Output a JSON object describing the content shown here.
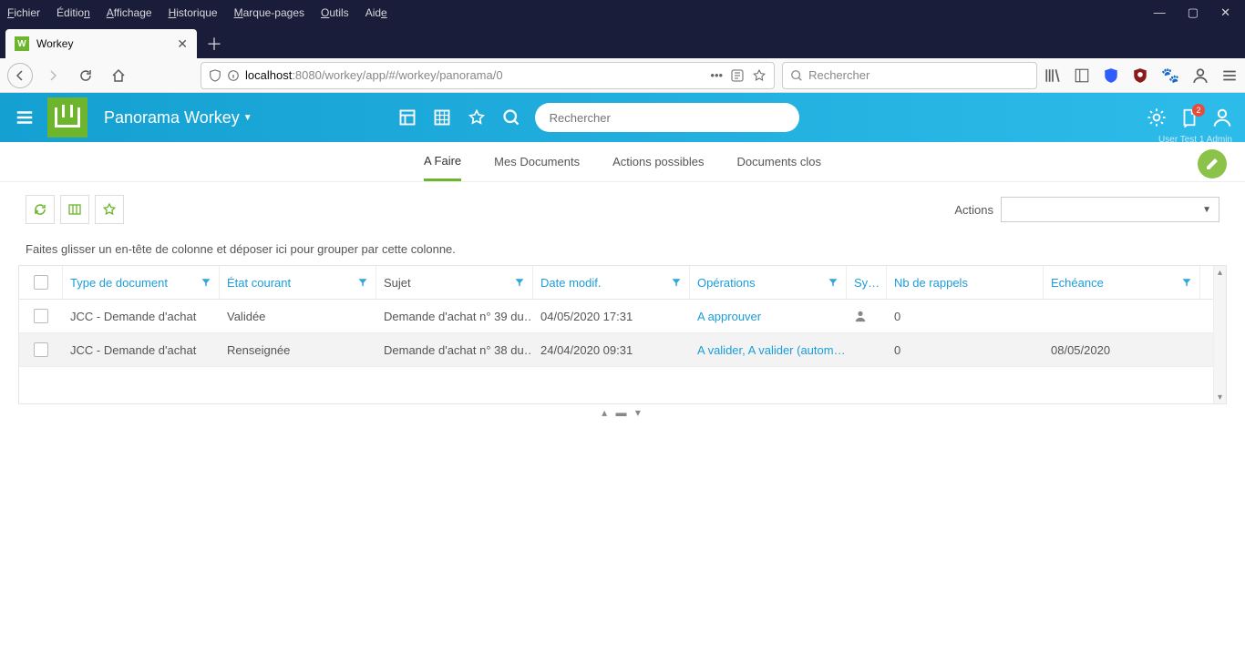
{
  "browser": {
    "menus": [
      "Fichier",
      "Édition",
      "Affichage",
      "Historique",
      "Marque-pages",
      "Outils",
      "Aide"
    ],
    "tab_title": "Workey",
    "url_prefix": "localhost",
    "url_port": ":8080",
    "url_path": "/workey/app/#/workey/panorama/0",
    "search_placeholder": "Rechercher"
  },
  "app": {
    "title": "Panorama Workey",
    "search_placeholder": "Rechercher",
    "notif_count": "2",
    "user_label": "User Test 1 Admin"
  },
  "tabs": {
    "t0": "A Faire",
    "t1": "Mes Documents",
    "t2": "Actions possibles",
    "t3": "Documents clos"
  },
  "toolbar": {
    "actions_label": "Actions"
  },
  "group_hint": "Faites glisser un en-tête de colonne et déposer ici pour grouper par cette colonne.",
  "columns": {
    "type": "Type de document",
    "etat": "État courant",
    "sujet": "Sujet",
    "date": "Date modif.",
    "oper": "Opérations",
    "sync": "Sy…",
    "rappel": "Nb de rappels",
    "eche": "Echéance"
  },
  "rows": [
    {
      "type": "JCC - Demande d'achat",
      "etat": "Validée",
      "sujet": "Demande d'achat n° 39 du…",
      "date": "04/05/2020 17:31",
      "oper": "A approuver",
      "sync_icon": "user",
      "rappel": "0",
      "eche": ""
    },
    {
      "type": "JCC - Demande d'achat",
      "etat": "Renseignée",
      "sujet": "Demande d'achat n° 38 du…",
      "date": "24/04/2020 09:31",
      "oper": "A valider, A valider (autom…",
      "sync_icon": "",
      "rappel": "0",
      "eche": "08/05/2020"
    }
  ]
}
